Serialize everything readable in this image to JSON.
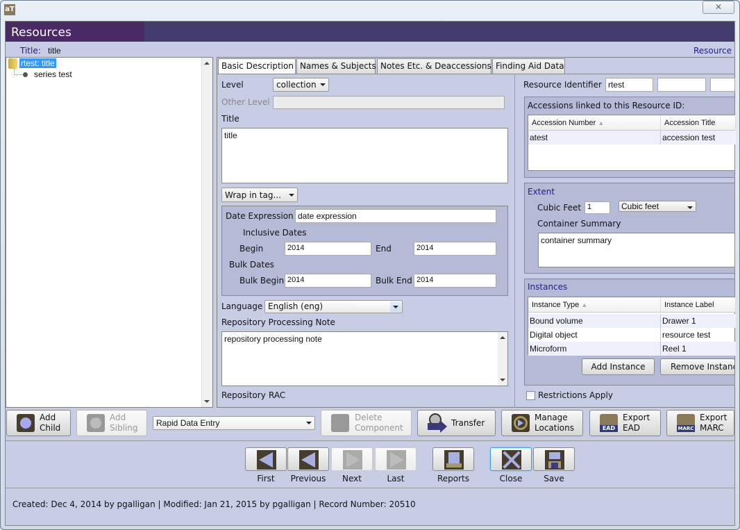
{
  "window": {
    "app_icon_label": "aT",
    "close_glyph": "✕"
  },
  "header": {
    "title": "Resources"
  },
  "title_bar": {
    "label": "Title:",
    "value": "title",
    "resource_link": "Resource"
  },
  "tree": {
    "root": "rtest: title",
    "children": [
      "series test"
    ]
  },
  "tabs": [
    {
      "label": "Basic Description",
      "active": true
    },
    {
      "label": "Names & Subjects",
      "active": false
    },
    {
      "label": "Notes Etc. & Deaccessions",
      "active": false
    },
    {
      "label": "Finding Aid Data",
      "active": false
    }
  ],
  "basic": {
    "level_label": "Level",
    "level_value": "collection",
    "other_level_label": "Other Level",
    "other_level_value": "",
    "title_label": "Title",
    "title_value": "title",
    "wrap_in_tag": "Wrap in tag...",
    "date_expression_label": "Date Expression",
    "date_expression_value": "date expression",
    "inclusive_dates_label": "Inclusive Dates",
    "begin_label": "Begin",
    "begin_value": "2014",
    "end_label": "End",
    "end_value": "2014",
    "bulk_dates_label": "Bulk Dates",
    "bulk_begin_label": "Bulk Begin",
    "bulk_begin_value": "2014",
    "bulk_end_label": "Bulk End",
    "bulk_end_value": "2014",
    "language_label": "Language",
    "language_value": "English (eng)",
    "repo_note_label": "Repository Processing Note",
    "repo_note_value": "repository processing note",
    "repository_label": "Repository",
    "repository_value": "RAC"
  },
  "right": {
    "resource_identifier_label": "Resource Identifier",
    "resource_identifier_values": [
      "rtest",
      "",
      ""
    ],
    "accessions_title": "Accessions linked to this Resource ID:",
    "accessions_columns": [
      "Accession Number",
      "Accession Title"
    ],
    "accessions_rows": [
      [
        "atest",
        "accession test"
      ]
    ],
    "extent_title": "Extent",
    "extent_label": "Cubic Feet",
    "extent_value": "1",
    "extent_type": "Cubic feet",
    "container_summary_label": "Container Summary",
    "container_summary_value": "container summary",
    "instances_title": "Instances",
    "instances_columns": [
      "Instance Type",
      "Instance Label"
    ],
    "instances_rows": [
      [
        "Bound volume",
        "Drawer 1"
      ],
      [
        "Digital object",
        "resource test"
      ],
      [
        "Microform",
        "Reel 1"
      ]
    ],
    "add_instance": "Add Instance",
    "remove_instance": "Remove Instance",
    "restrictions_label": "Restrictions Apply",
    "restrictions_checked": false
  },
  "toolbar": {
    "add_child": [
      "Add",
      "Child"
    ],
    "add_sibling": [
      "Add",
      "Sibling"
    ],
    "rapid_entry": "Rapid Data Entry",
    "delete_component": [
      "Delete",
      "Component"
    ],
    "transfer": "Transfer",
    "manage_locations": [
      "Manage",
      "Locations"
    ],
    "export_ead": [
      "Export",
      "EAD"
    ],
    "export_marc": [
      "Export",
      "MARC"
    ],
    "ead_badge": "EAD",
    "marc_badge": "MARC"
  },
  "nav": {
    "first": "First",
    "previous": "Previous",
    "next": "Next",
    "last": "Last",
    "reports": "Reports",
    "close": "Close",
    "save": "Save"
  },
  "status": "Created: Dec 4, 2014 by pgalligan | Modified: Jan 21, 2015 by pgalligan | Record Number: 20510"
}
